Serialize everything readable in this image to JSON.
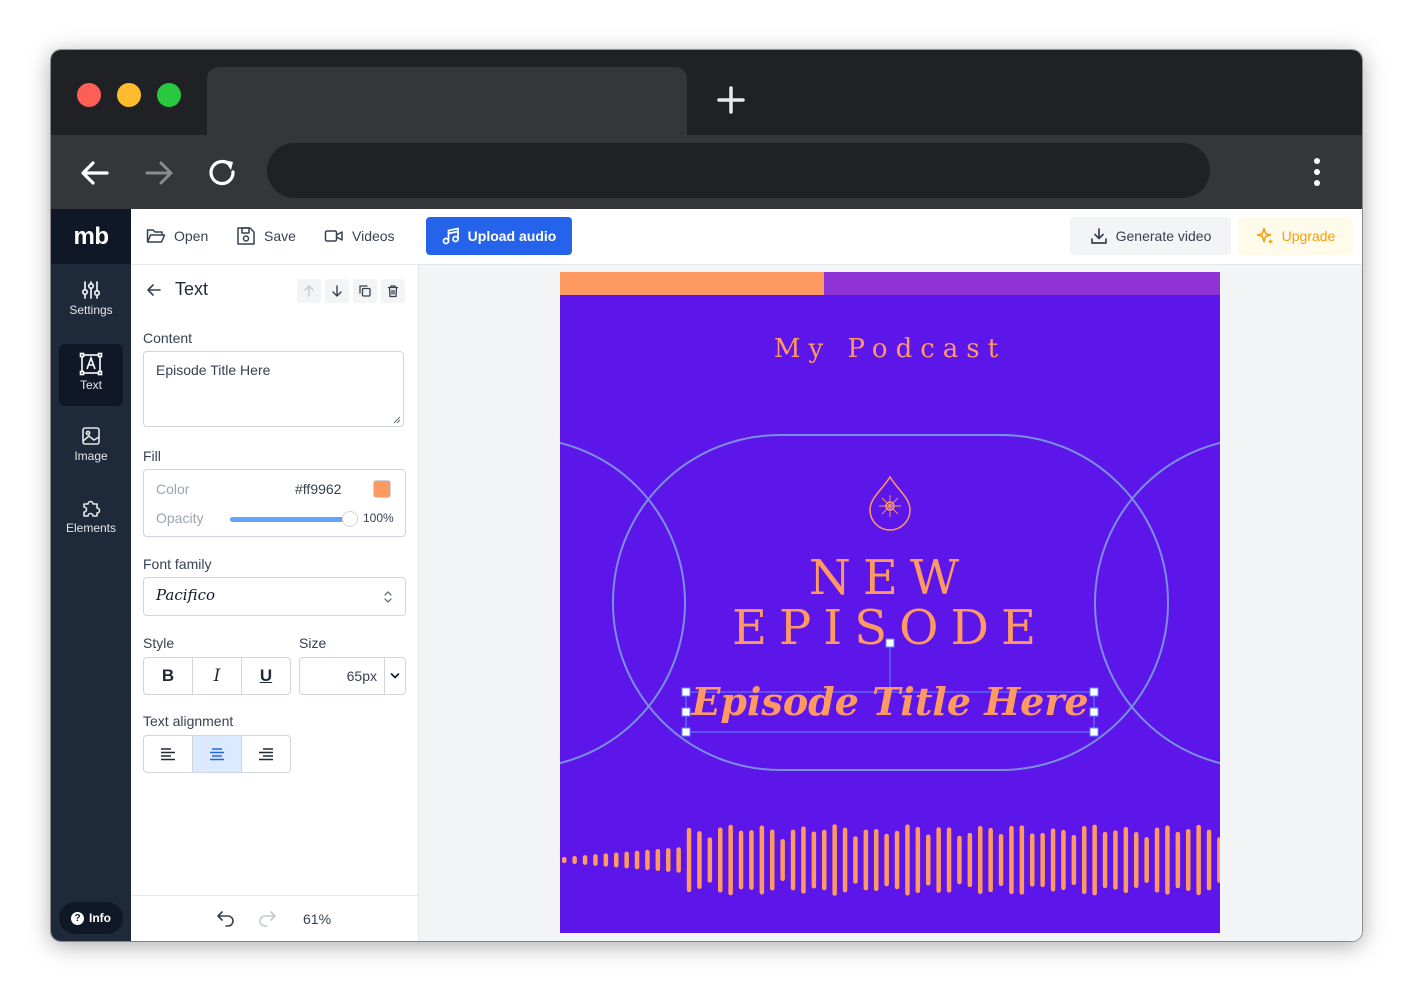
{
  "app": {
    "logo": "mb",
    "rail": [
      {
        "label": "Settings",
        "icon": "sliders-icon"
      },
      {
        "label": "Text",
        "icon": "text-icon"
      },
      {
        "label": "Image",
        "icon": "image-icon"
      },
      {
        "label": "Elements",
        "icon": "puzzle-icon"
      }
    ],
    "info_label": "Info"
  },
  "topbar": {
    "open_label": "Open",
    "save_label": "Save",
    "videos_label": "Videos",
    "upload_label": "Upload audio",
    "generate_label": "Generate video",
    "upgrade_label": "Upgrade"
  },
  "panel": {
    "title": "Text",
    "content_label": "Content",
    "content_value": "Episode Title Here",
    "fill_label": "Fill",
    "color_label": "Color",
    "color_hex": "#ff9962",
    "opacity_label": "Opacity",
    "opacity_value": "100%",
    "opacity_fraction": 1.0,
    "font_family_label": "Font family",
    "font_family_value": "Pacifico",
    "style_label": "Style",
    "size_label": "Size",
    "size_value": "65px",
    "style_buttons": [
      "B",
      "I",
      "U"
    ],
    "alignment_label": "Text alignment",
    "alignment_selected": "center",
    "zoom": "61%"
  },
  "poster": {
    "podcast_title": "My Podcast",
    "headline_1": "NEW",
    "headline_2": "EPISODE",
    "episode_title": "Episode Title Here",
    "colors": {
      "background": "#5d16ea",
      "accent": "#ff9962",
      "secondary": "#8f33d6",
      "lines": "#7b8fe0"
    }
  }
}
